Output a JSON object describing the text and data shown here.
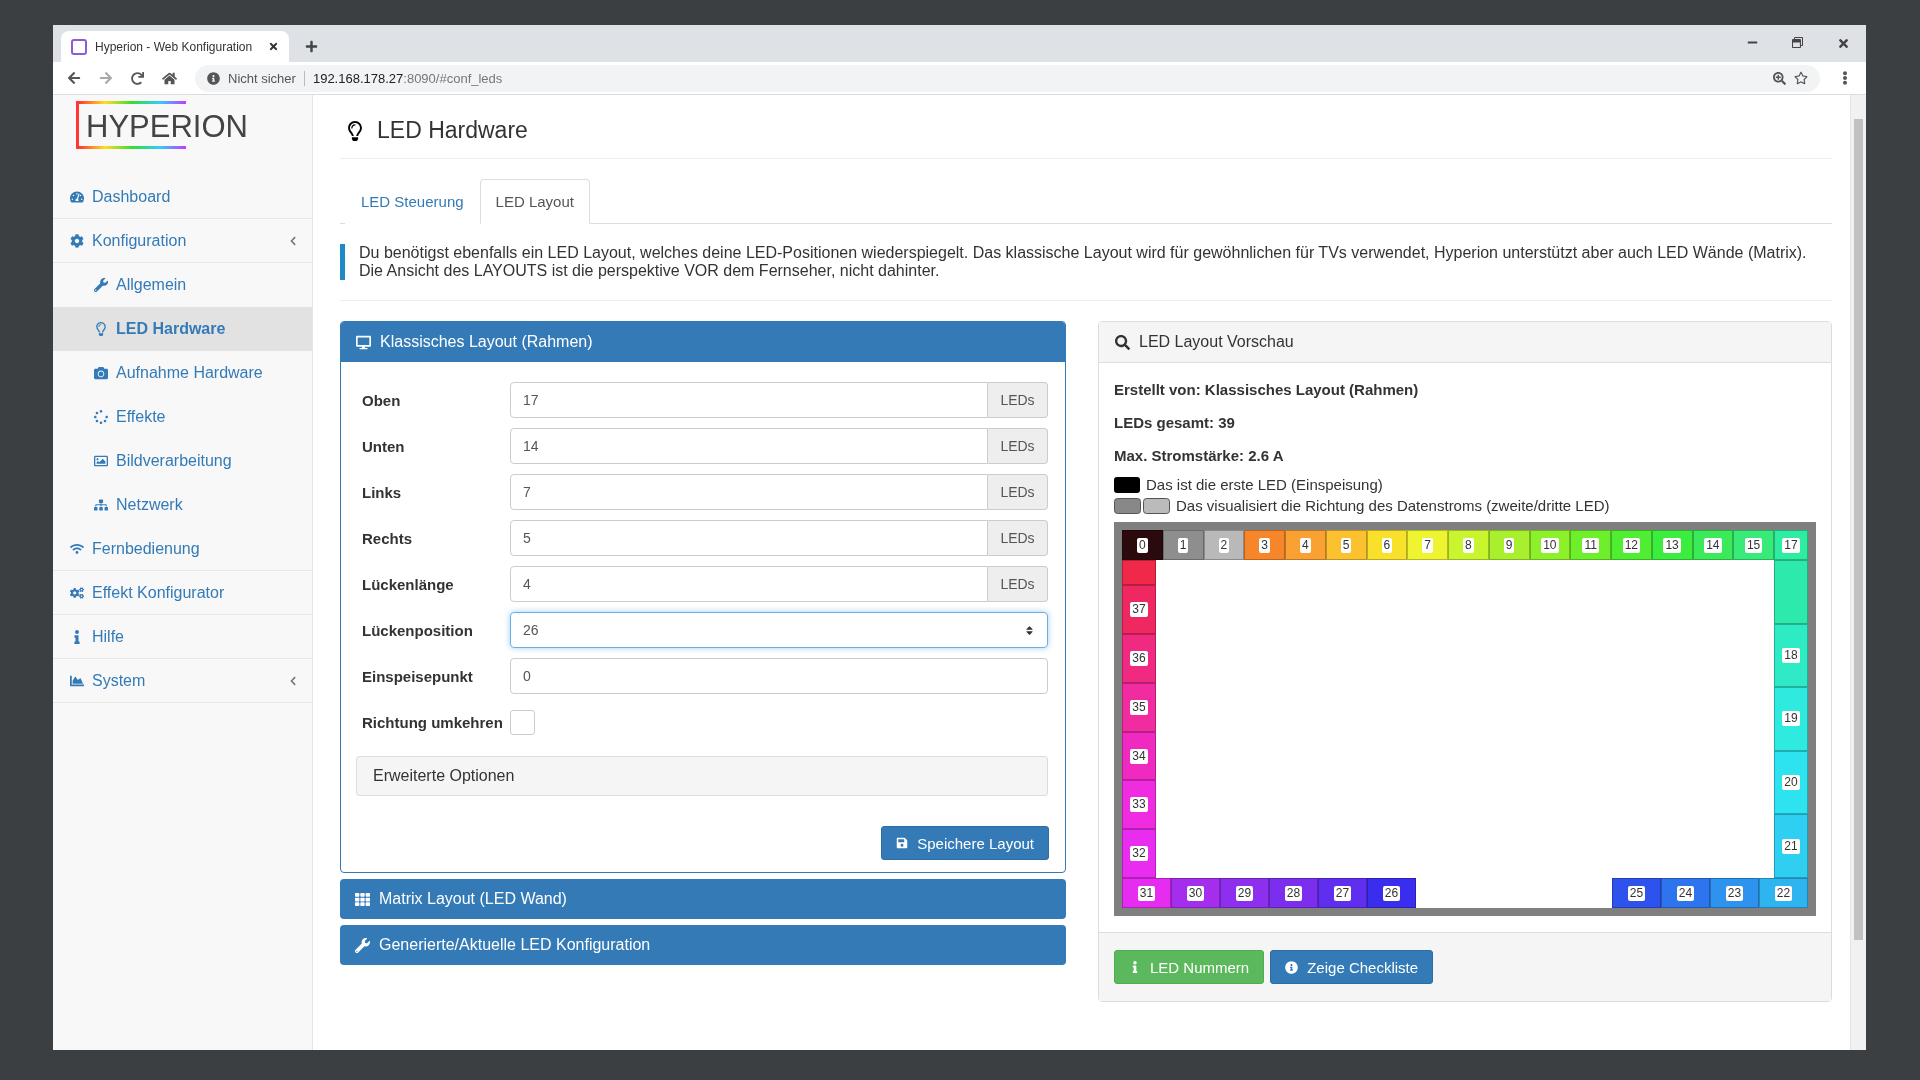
{
  "browser": {
    "tab_title": "Hyperion - Web Konfiguration",
    "security": "Nicht sicher",
    "url_host": "192.168.178.27",
    "url_path": ":8090/#conf_leds"
  },
  "sidebar": {
    "logo": "HYPERION",
    "items": [
      {
        "label": "Dashboard",
        "selected": false
      },
      {
        "label": "Konfiguration",
        "selected": false,
        "submenu": true,
        "children": [
          {
            "label": "Allgemein",
            "selected": false
          },
          {
            "label": "LED Hardware",
            "selected": true
          },
          {
            "label": "Aufnahme Hardware",
            "selected": false
          },
          {
            "label": "Effekte",
            "selected": false
          },
          {
            "label": "Bildverarbeitung",
            "selected": false
          },
          {
            "label": "Netzwerk",
            "selected": false
          }
        ]
      },
      {
        "label": "Fernbedienung",
        "selected": false
      },
      {
        "label": "Effekt Konfigurator",
        "selected": false
      },
      {
        "label": "Hilfe",
        "selected": false
      },
      {
        "label": "System",
        "selected": false,
        "submenu": true
      }
    ]
  },
  "page": {
    "title": "LED Hardware",
    "tabs": [
      {
        "label": "LED Steuerung",
        "selected": false
      },
      {
        "label": "LED Layout",
        "selected": true
      }
    ],
    "info": "Du benötigst ebenfalls ein LED Layout, welches deine LED-Positionen wiederspiegelt. Das klassische Layout wird für gewöhnlichen für TVs verwendet, Hyperion unterstützt aber auch LED Wände (Matrix). Die Ansicht des LAYOUTS ist die perspektive VOR dem Fernseher, nicht dahinter.",
    "panels": [
      {
        "title": "Klassisches Layout (Rahmen)",
        "expanded": true
      },
      {
        "title": "Matrix Layout (LED Wand)",
        "expanded": false
      },
      {
        "title": "Generierte/Aktuelle LED Konfiguration",
        "expanded": false
      }
    ],
    "form": {
      "rows": [
        {
          "kind": "addon",
          "label": "Oben",
          "value": "17",
          "unit": "LEDs"
        },
        {
          "kind": "addon",
          "label": "Unten",
          "value": "14",
          "unit": "LEDs"
        },
        {
          "kind": "addon",
          "label": "Links",
          "value": "7",
          "unit": "LEDs"
        },
        {
          "kind": "addon",
          "label": "Rechts",
          "value": "5",
          "unit": "LEDs"
        },
        {
          "kind": "addon",
          "label": "Lückenlänge",
          "value": "4",
          "unit": "LEDs"
        },
        {
          "kind": "select",
          "label": "Lückenposition",
          "value": "26"
        },
        {
          "kind": "text",
          "label": "Einspeisepunkt",
          "value": "0"
        },
        {
          "kind": "checkbox",
          "label": "Richtung umkehren",
          "checked": false
        }
      ],
      "advanced": "Erweiterte Optionen",
      "save": "Speichere Layout"
    },
    "preview": {
      "title": "LED Layout Vorschau",
      "info": [
        "Erstellt von: Klassisches Layout (Rahmen)",
        "LEDs gesamt: 39",
        "Max. Stromstärke: 2.6 A"
      ],
      "legend": [
        "Das ist die erste LED (Einspeisung)",
        "Das visualisiert die Richtung des Datenstroms (zweite/dritte LED)"
      ],
      "top": [
        {
          "label": "0",
          "color": "#2a0a0c"
        },
        {
          "label": "1",
          "color": "#8e8e8e"
        },
        {
          "label": "2",
          "color": "#b9b9b9"
        },
        {
          "label": "3",
          "color": "#f7862a"
        },
        {
          "label": "4",
          "color": "#f9a132"
        },
        {
          "label": "5",
          "color": "#fbc12e"
        },
        {
          "label": "6",
          "color": "#f9e02a"
        },
        {
          "label": "7",
          "color": "#eef530"
        },
        {
          "label": "8",
          "color": "#c8f52e"
        },
        {
          "label": "9",
          "color": "#a8f02e"
        },
        {
          "label": "10",
          "color": "#8cf02a"
        },
        {
          "label": "11",
          "color": "#6eef2c"
        },
        {
          "label": "12",
          "color": "#4fee33"
        },
        {
          "label": "13",
          "color": "#3cec3e"
        },
        {
          "label": "14",
          "color": "#3aea58"
        },
        {
          "label": "15",
          "color": "#38ea78"
        },
        {
          "label": "17",
          "color": "#2eeda0"
        }
      ],
      "right": [
        {
          "color": "#2ee9ac"
        },
        {
          "label": "18",
          "color": "#2eebc5"
        },
        {
          "label": "19",
          "color": "#2eeadf"
        },
        {
          "label": "20",
          "color": "#2de3ef"
        },
        {
          "label": "21",
          "color": "#2ecff0"
        }
      ],
      "bottom_left": [
        {
          "label": "31",
          "color": "#e62cf0"
        },
        {
          "label": "30",
          "color": "#a52eee"
        },
        {
          "label": "29",
          "color": "#8e2eee"
        },
        {
          "label": "28",
          "color": "#7b2eee"
        },
        {
          "label": "27",
          "color": "#602eee"
        },
        {
          "label": "26",
          "color": "#3a2eee"
        }
      ],
      "bottom_right": [
        {
          "label": "25",
          "color": "#2e52ee"
        },
        {
          "label": "24",
          "color": "#2e74ee"
        },
        {
          "label": "23",
          "color": "#2e93ee"
        },
        {
          "label": "22",
          "color": "#2eb5f0"
        }
      ],
      "left": [
        {
          "color": "#f0284a"
        },
        {
          "label": "37",
          "color": "#f02862"
        },
        {
          "label": "36",
          "color": "#f02a80"
        },
        {
          "label": "35",
          "color": "#f02ca0"
        },
        {
          "label": "34",
          "color": "#f02ac0"
        },
        {
          "label": "33",
          "color": "#f02ce0"
        },
        {
          "label": "32",
          "color": "#e82cf0"
        }
      ],
      "buttons": [
        {
          "kind": "success",
          "label": "LED Nummern"
        },
        {
          "kind": "primary",
          "label": "Zeige Checkliste"
        }
      ]
    }
  }
}
